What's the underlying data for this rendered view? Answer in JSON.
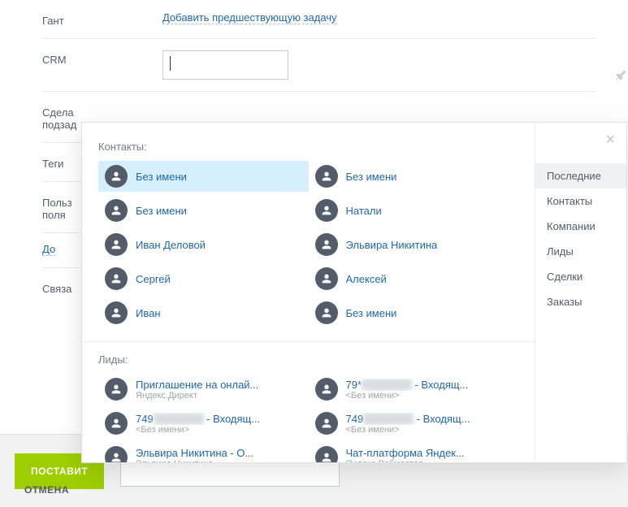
{
  "form": {
    "gantt_label": "Гант",
    "gantt_link": "Добавить предшествующую задачу",
    "crm_label": "CRM",
    "crm_value": "",
    "subtask_label": "Сдела\nподзад",
    "tags_label": "Теги",
    "custom_label": "Польз\nполя",
    "custom_add": "До",
    "bind_label": "Связа"
  },
  "footer": {
    "primary": "ПОСТАВИТ",
    "cancel": "ОТМЕНА"
  },
  "popup": {
    "contacts_title": "Контакты:",
    "leads_title": "Лиды:",
    "contacts": [
      {
        "name": "Без имени",
        "selected": true
      },
      {
        "name": "Без имени"
      },
      {
        "name": "Без имени"
      },
      {
        "name": "Натали"
      },
      {
        "name": "Иван Деловой"
      },
      {
        "name": "Эльвира Никитина"
      },
      {
        "name": "Сергей"
      },
      {
        "name": "Алексей"
      },
      {
        "name": "Иван"
      },
      {
        "name": "Без имени"
      }
    ],
    "leads": [
      {
        "name": "Приглашение на онлай...",
        "sub": "Яндекс.Директ"
      },
      {
        "name": "79********* - Входящ...",
        "sub": "<Без имени>",
        "masked": true
      },
      {
        "name": "749******** - Входящ...",
        "sub": "<Без имени>",
        "masked": true
      },
      {
        "name": "749******** - Входящ...",
        "sub": "<Без имени>",
        "masked": true
      },
      {
        "name": "Эльвира Никитина - О...",
        "sub": "Эльвира Никитина"
      },
      {
        "name": "Чат-платформа Яндек...",
        "sub": "Яндекс.Вебмастер"
      }
    ],
    "tabs": [
      {
        "label": "Последние",
        "active": true
      },
      {
        "label": "Контакты"
      },
      {
        "label": "Компании"
      },
      {
        "label": "Лиды"
      },
      {
        "label": "Сделки"
      },
      {
        "label": "Заказы"
      }
    ]
  }
}
